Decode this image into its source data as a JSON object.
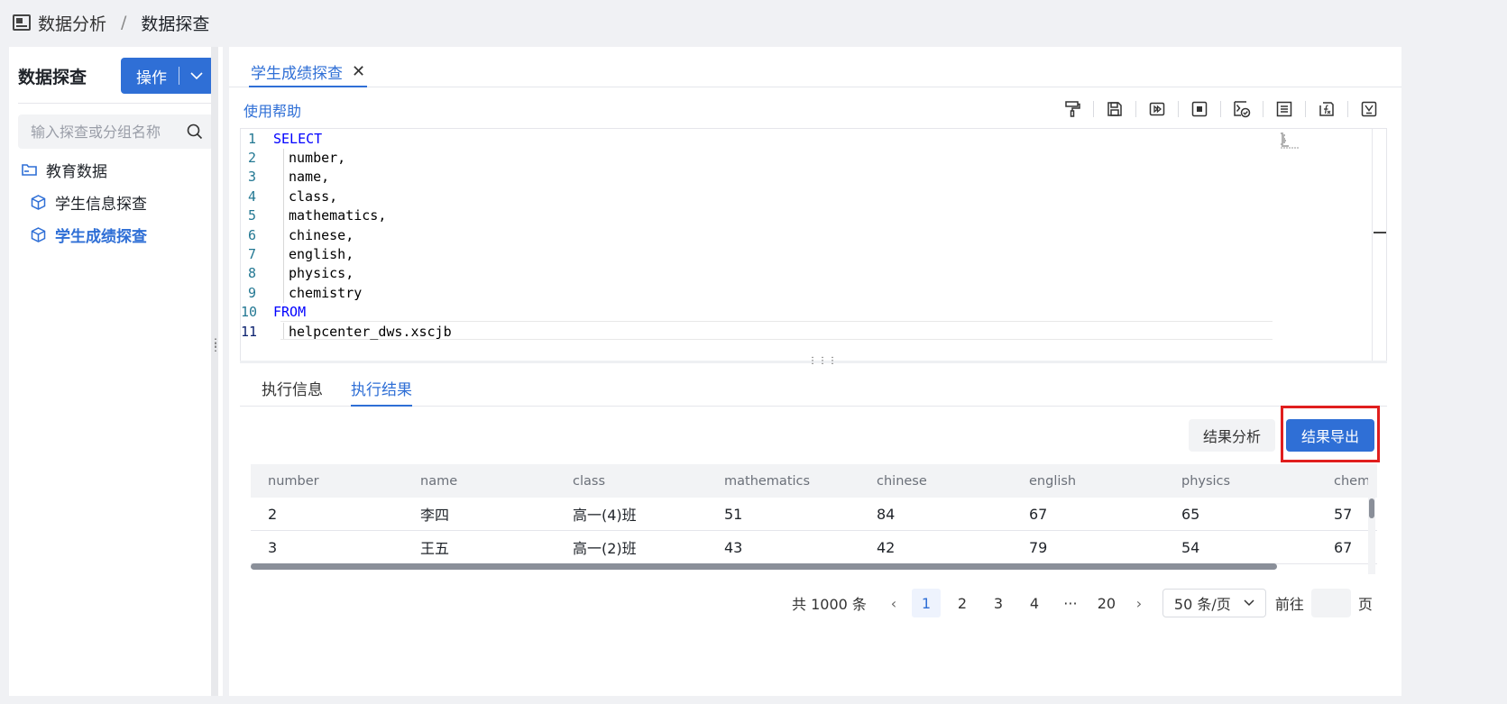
{
  "breadcrumb": {
    "parent": "数据分析",
    "separator": "/",
    "current": "数据探查"
  },
  "left_panel": {
    "title": "数据探查",
    "op_button": "操作",
    "search_placeholder": "输入探查或分组名称",
    "tree": {
      "folder": "教育数据",
      "items": [
        {
          "label": "学生信息探查",
          "active": false
        },
        {
          "label": "学生成绩探查",
          "active": true
        }
      ]
    }
  },
  "tab": {
    "label": "学生成绩探查",
    "close": "✕"
  },
  "help_link": "使用帮助",
  "toolbar": {
    "icons": [
      "format-brush-icon",
      "save-icon",
      "run-icon",
      "stop-icon",
      "check-sql-icon",
      "list-icon",
      "function-icon",
      "variable-icon"
    ]
  },
  "editor": {
    "lines": [
      {
        "num": "1",
        "text": "SELECT",
        "keyword": true
      },
      {
        "num": "2",
        "text": "number,",
        "keyword": false
      },
      {
        "num": "3",
        "text": "name,",
        "keyword": false
      },
      {
        "num": "4",
        "text": "class,",
        "keyword": false
      },
      {
        "num": "5",
        "text": "mathematics,",
        "keyword": false
      },
      {
        "num": "6",
        "text": "chinese,",
        "keyword": false
      },
      {
        "num": "7",
        "text": "english,",
        "keyword": false
      },
      {
        "num": "8",
        "text": "physics,",
        "keyword": false
      },
      {
        "num": "9",
        "text": "chemistry",
        "keyword": false
      },
      {
        "num": "10",
        "text": "FROM",
        "keyword": true
      },
      {
        "num": "11",
        "text": "helpcenter_dws.xscjb",
        "keyword": false
      }
    ]
  },
  "result_tabs": {
    "info": "执行信息",
    "result": "执行结果"
  },
  "buttons": {
    "analysis": "结果分析",
    "export": "结果导出"
  },
  "table": {
    "columns": [
      "number",
      "name",
      "class",
      "mathematics",
      "chinese",
      "english",
      "physics",
      "chemi"
    ],
    "rows": [
      [
        "2",
        "李四",
        "高一(4)班",
        "51",
        "84",
        "67",
        "65",
        "57"
      ],
      [
        "3",
        "王五",
        "高一(2)班",
        "43",
        "42",
        "79",
        "54",
        "67"
      ]
    ]
  },
  "pagination": {
    "total": "共 1000 条",
    "pages": [
      "1",
      "2",
      "3",
      "4",
      "···",
      "20"
    ],
    "current": "1",
    "page_size": "50 条/页",
    "goto_label": "前往",
    "page_suffix": "页"
  },
  "colors": {
    "accent": "#2f6fd6",
    "highlight": "#e01e1e",
    "keyword": "#0000ff",
    "line_number": "#237893"
  }
}
